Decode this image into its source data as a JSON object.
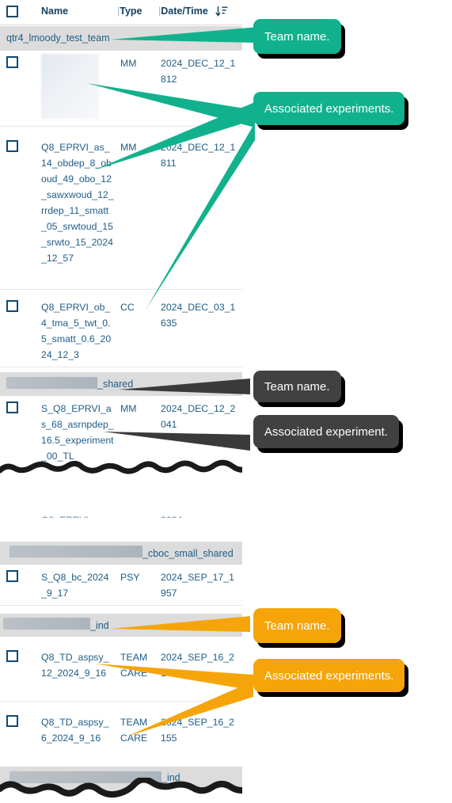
{
  "table": {
    "header": {
      "checkbox": "",
      "name": "Name",
      "type": "Type",
      "date": "Date/Time",
      "separator": "|",
      "sort_icon": "sort-descending-icon"
    },
    "groups": [
      {
        "team_name": "qtr4_lmoody_test_team",
        "redacted": false,
        "rows": [
          {
            "name": "",
            "name_redacted": true,
            "type": "MM",
            "date": "2024_DEC_12_1812"
          },
          {
            "name": "Q8_EPRVI_as_14_obdep_8_oboud_49_obo_12_sawxwoud_12_rrdep_11_smatt_05_srwtoud_15_srwto_15_2024_12_57",
            "name_redacted": false,
            "type": "MM",
            "date": "2024_DEC_12_1811"
          },
          {
            "name": "Q8_EPRVI_ob_4_tma_5_twt_0.5_smatt_0.6_2024_12_3",
            "name_redacted": false,
            "type": "CC",
            "date": "2024_DEC_03_1635"
          }
        ]
      },
      {
        "team_name": "_shared",
        "redacted": true,
        "rows": [
          {
            "name": "S_Q8_EPRVI_as_68_asrnpdep_16.5_experiment_00_TL",
            "name_redacted": false,
            "type": "MM",
            "date": "2024_DEC_12_2041"
          }
        ]
      },
      {
        "team_name": "_cboc_small_shared",
        "redacted": true,
        "rows": [
          {
            "name": "S_Q8_bc_2024_9_17",
            "name_redacted": false,
            "type": "PSY",
            "date": "2024_SEP_17_1957"
          }
        ]
      },
      {
        "team_name": "_ind",
        "redacted": true,
        "rows": [
          {
            "name": "Q8_TD_aspsy_12_2024_9_16",
            "name_redacted": false,
            "type": "TEAM CARE",
            "date": "2024_SEP_16_2158"
          },
          {
            "name": "Q8_TD_aspsy_6_2024_9_16",
            "name_redacted": false,
            "type": "TEAM CARE",
            "date": "2024_SEP_16_2155"
          }
        ]
      },
      {
        "team_name": "_ind",
        "redacted": true,
        "rows": []
      }
    ]
  },
  "callouts": [
    {
      "id": "teal-team",
      "label": "Team name.",
      "color": "#12b18d"
    },
    {
      "id": "teal-exps",
      "label": "Associated experiments.",
      "color": "#12b18d"
    },
    {
      "id": "dark-team",
      "label": "Team name.",
      "color": "#414141"
    },
    {
      "id": "dark-exp",
      "label": "Associated experiment.",
      "color": "#414141"
    },
    {
      "id": "orange-team",
      "label": "Team name.",
      "color": "#f5a50a"
    },
    {
      "id": "orange-exps",
      "label": "Associated experiments.",
      "color": "#f5a50a"
    }
  ],
  "colors": {
    "teal": "#12b18d",
    "dark": "#414141",
    "orange": "#f5a50a",
    "checkbox_border": "#0b4a75",
    "link_text": "#1f5c86",
    "group_row_bg": "#dcdcdc",
    "shadow": "#000000"
  }
}
